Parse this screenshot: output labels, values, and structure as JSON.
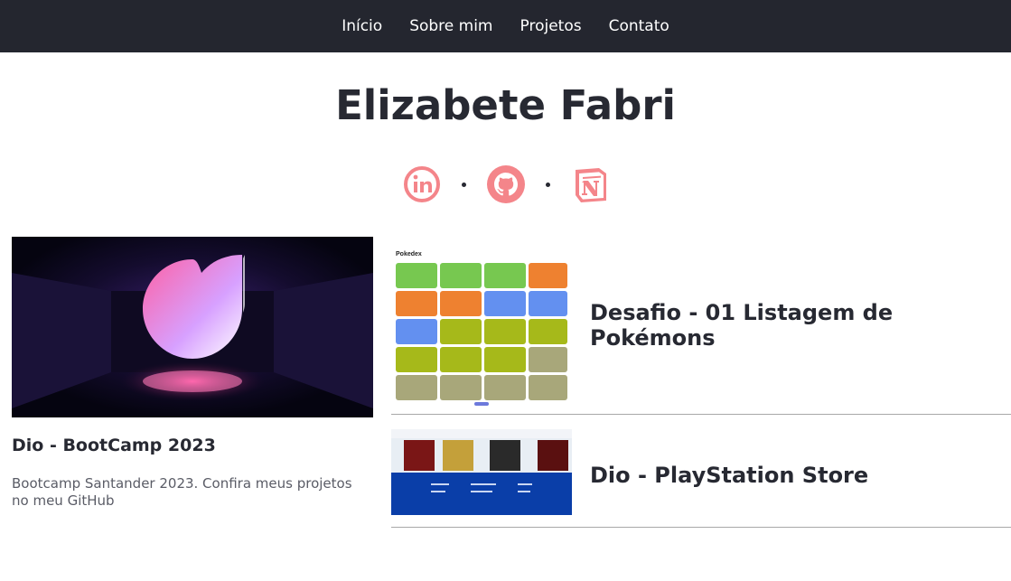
{
  "nav": {
    "items": [
      "Início",
      "Sobre mim",
      "Projetos",
      "Contato"
    ]
  },
  "header": {
    "name": "Elizabete Fabri"
  },
  "social": {
    "icons": [
      "linkedin-icon",
      "github-icon",
      "notion-icon"
    ],
    "color": "#f4858a"
  },
  "featured": {
    "title": "Dio - BootCamp 2023",
    "description": "Bootcamp Santander 2023. Confira meus projetos no meu GitHub"
  },
  "projects": [
    {
      "title": "Desafio - 01 Listagem de Pokémons",
      "thumb_heading": "Pokedex"
    },
    {
      "title": "Dio - PlayStation Store"
    }
  ],
  "colors": {
    "nav_bg": "#24262f",
    "text": "#272932",
    "accent": "#f4858a"
  }
}
